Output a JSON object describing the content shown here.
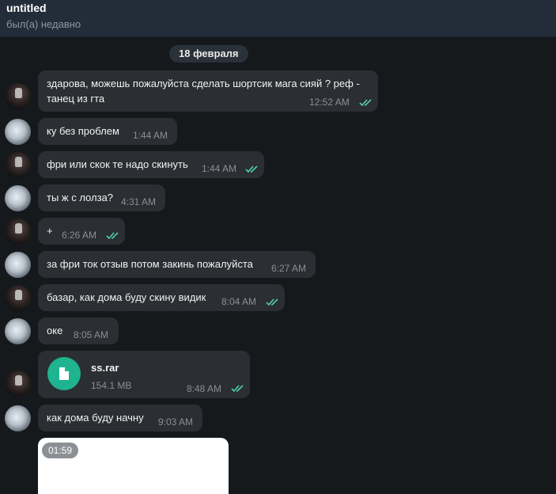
{
  "header": {
    "title": "untitled",
    "status": "был(а) недавно"
  },
  "date_divider": "18 февраля",
  "messages": [
    {
      "id": "m1",
      "sender": "me",
      "lines": [
        "здарова, можешь пожалуйста сделать шортсик мага сияй ? реф  -",
        "танец из гта"
      ],
      "time": "12:52 AM",
      "read": true
    },
    {
      "id": "m2",
      "sender": "them",
      "text": "ку без проблем",
      "time": "1:44 AM"
    },
    {
      "id": "m3",
      "sender": "me",
      "text": "фри или скок те надо скинуть",
      "time": "1:44 AM",
      "read": true
    },
    {
      "id": "m4",
      "sender": "them",
      "text": "ты ж с лолза?",
      "time": "4:31 AM"
    },
    {
      "id": "m5",
      "sender": "me",
      "text": "+",
      "time": "6:26 AM",
      "read": true
    },
    {
      "id": "m6",
      "sender": "them",
      "text": "за фри ток отзыв потом закинь пожалуйста",
      "time": "6:27 AM"
    },
    {
      "id": "m7",
      "sender": "me",
      "text": "базар, как дома буду скину видик",
      "time": "8:04 AM",
      "read": true
    },
    {
      "id": "m8",
      "sender": "them",
      "text": "оке",
      "time": "8:05 AM"
    },
    {
      "id": "m9",
      "sender": "me",
      "file": {
        "name": "ss.rar",
        "size": "154.1 MB",
        "icon": "file-icon"
      },
      "time": "8:48 AM",
      "read": true
    },
    {
      "id": "m10",
      "sender": "them",
      "text": "как дома буду начну",
      "time": "9:03 AM"
    }
  ],
  "video": {
    "duration": "01:59"
  },
  "colors": {
    "header_bg": "#232d3a",
    "chat_bg": "#16191c",
    "bubble_bg": "#2b2e32",
    "read_tick": "#4fd1b0",
    "file_icon_bg": "#1fb38f"
  }
}
